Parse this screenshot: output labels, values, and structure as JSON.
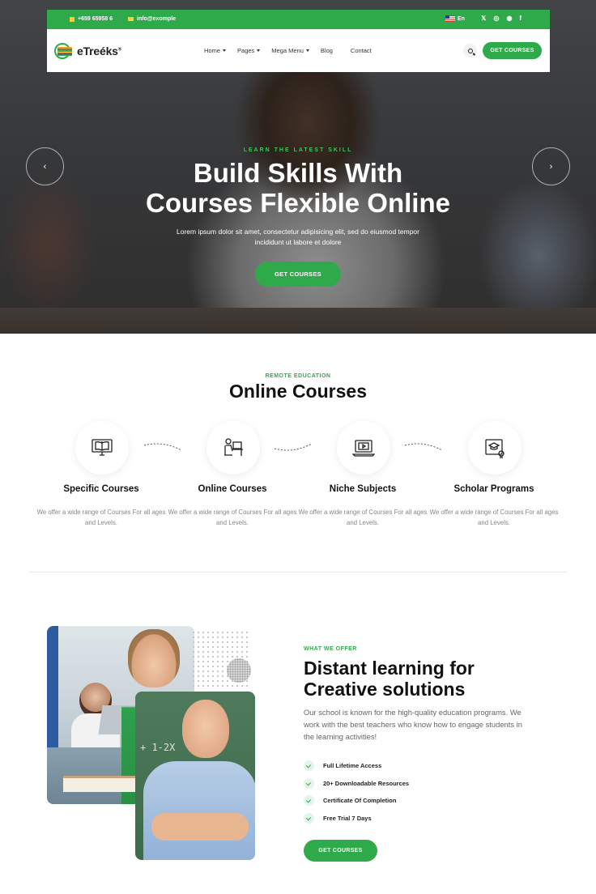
{
  "topbar": {
    "phone": "+659 65958 6",
    "email": "info@exomple",
    "language": "En",
    "social_icons": [
      "twitter-icon",
      "instagram-icon",
      "dribbble-icon",
      "facebook-icon"
    ]
  },
  "brand": {
    "name": "eTreéks",
    "reg_mark": "®"
  },
  "nav": {
    "items": [
      {
        "label": "Home",
        "dropdown": true
      },
      {
        "label": "Pages",
        "dropdown": true
      },
      {
        "label": "Mega Menu",
        "dropdown": true
      },
      {
        "label": "Blog",
        "dropdown": false
      },
      {
        "label": "Contact",
        "dropdown": false
      }
    ],
    "cta": "GET COURSES"
  },
  "hero": {
    "kicker": "LEARN THE LATEST SKILL",
    "title_line1": "Build Skills With",
    "title_line2": "Courses Flexible Online",
    "subtitle": "Lorem ipsum dolor sit amet, consectetur adipisicing elit, sed do eiusmod tempor incididunt ut labore et dolore",
    "cta": "GET COURSES",
    "prev_arrow": "‹",
    "next_arrow": "›"
  },
  "courses": {
    "kicker": "REMOTE EDUCATION",
    "title": "Online Courses",
    "items": [
      {
        "name": "Specific Courses",
        "desc": "We offer a wide range of Courses For all ages and Levels.",
        "icon": "book-monitor-icon"
      },
      {
        "name": "Online Courses",
        "desc": "We offer a wide range of Courses For all ages and Levels.",
        "icon": "desk-student-icon"
      },
      {
        "name": "Niche Subjects",
        "desc": "We offer a wide range of Courses For all ages and Levels.",
        "icon": "laptop-video-icon"
      },
      {
        "name": "Scholar Programs",
        "desc": "We offer a wide range of Courses For all ages and Levels.",
        "icon": "graduation-certificate-icon"
      }
    ]
  },
  "about": {
    "kicker": "WHAT WE OFFER",
    "title_line1": "Distant learning for",
    "title_line2": "Creative solutions",
    "description": "Our school is known for the high-quality education programs. We work with the best teachers who know how to engage students in the learning activities!",
    "features": [
      "Full Lifetime Access",
      "20+ Downloadable Resources",
      "Certificate Of Completion",
      "Free Trial 7 Days"
    ],
    "cta": "GET COURSES",
    "chalk_text": "+ 1-2X"
  },
  "colors": {
    "accent": "#2faa4a",
    "accent_light": "#3cc35a",
    "text_dark": "#111111",
    "text_muted": "#888888"
  }
}
